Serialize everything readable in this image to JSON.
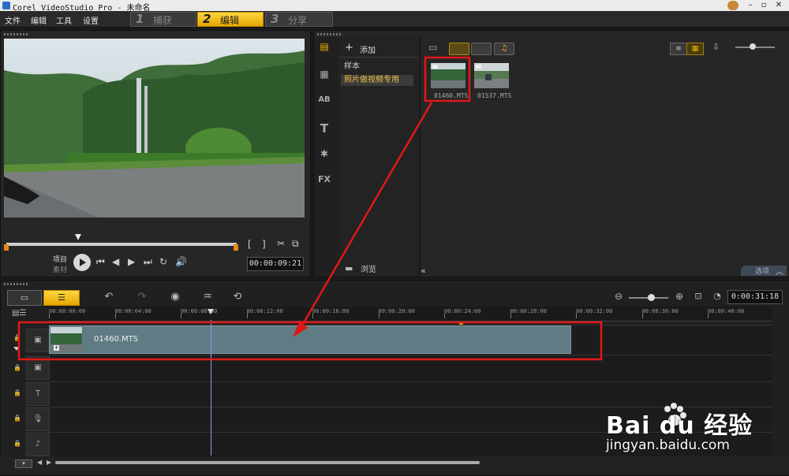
{
  "window": {
    "title": "Corel VideoStudio Pro - 未命名",
    "controls": [
      "–",
      "▫",
      "✕"
    ]
  },
  "menu": {
    "items": [
      "文件",
      "编辑",
      "工具",
      "设置"
    ]
  },
  "steps": [
    {
      "num": "1",
      "label": "捕获"
    },
    {
      "num": "2",
      "label": "编辑",
      "active": true
    },
    {
      "num": "3",
      "label": "分享"
    }
  ],
  "player": {
    "mode_project": "项目",
    "mode_clip": "素材",
    "timecode": "00:00:09:21"
  },
  "library": {
    "add_label": "添加",
    "folders": [
      "样本",
      "照片做视频专用"
    ],
    "selected_folder": "照片做视频专用",
    "browse_label": "浏览",
    "options_label": "选项",
    "thumbnails": [
      {
        "caption": "01460.MTS",
        "selected": true
      },
      {
        "caption": "01537.MTS",
        "selected": false
      }
    ]
  },
  "timeline": {
    "timecode": "0:00:31:18",
    "ruler": [
      "00:00:00:00",
      "00:00:04:00",
      "00:00:08:00",
      "00:00:12:00",
      "00:00:16:00",
      "00:00:20:00",
      "00:00:24:00",
      "00:00:28:00",
      "00:00:32:00",
      "00:00:36:00",
      "00:00:40:00"
    ],
    "clip_name": "01460.MTS"
  },
  "watermark": {
    "brand": "Bai du 经验",
    "url": "jingyan.baidu.com"
  },
  "colors": {
    "accent_yellow": "#f0b400",
    "annotation_red": "#e01818",
    "clip_fill": "#5f7b84"
  }
}
